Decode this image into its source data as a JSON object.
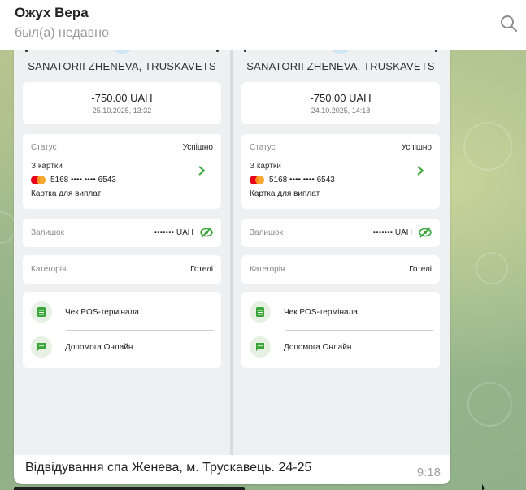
{
  "header": {
    "chat_name": "Ожух Вера",
    "status": "был(а) недавно",
    "search_icon": "search-icon"
  },
  "message": {
    "caption": "Відвідування спа Женева, м. Трускавець. 24-25",
    "time": "9:18",
    "receipts": [
      {
        "merchant": "SANATORII ZHENEVA, TRUSKAVETS",
        "amount": "-750.00 UAH",
        "datetime": "25.10.2025, 13:32",
        "status_label": "Статус",
        "status_value": "Успішно",
        "from_label": "З картки",
        "card_number": "5168 •••• •••• 6543",
        "card_type": "Картка для виплат",
        "balance_label": "Залишок",
        "balance_value": "••••••• UAH",
        "category_label": "Категорія",
        "category_value": "Готелі",
        "actions": [
          "Чек POS-термінала",
          "Допомога Онлайн"
        ]
      },
      {
        "merchant": "SANATORII ZHENEVA, TRUSKAVETS",
        "amount": "-750.00 UAH",
        "datetime": "24.10.2025, 14:18",
        "status_label": "Статус",
        "status_value": "Успішно",
        "from_label": "З картки",
        "card_number": "5168 •••• •••• 6543",
        "card_type": "Картка для виплат",
        "balance_label": "Залишок",
        "balance_value": "••••••• UAH",
        "category_label": "Категорія",
        "category_value": "Готелі",
        "actions": [
          "Чек POS-термінала",
          "Допомога Онлайн"
        ]
      }
    ]
  },
  "colors": {
    "accent_green": "#3aa63a",
    "mastercard_red": "#eb001b",
    "mastercard_orange": "#f79e1b"
  }
}
